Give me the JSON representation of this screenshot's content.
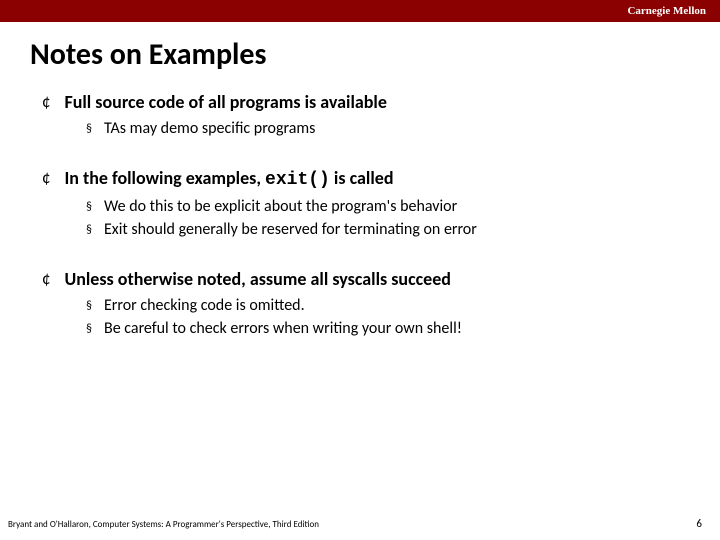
{
  "header": {
    "org": "Carnegie Mellon"
  },
  "title": "Notes on Examples",
  "bullets": [
    {
      "text": "Full source code of all programs is available",
      "sub": [
        "TAs may demo specific programs"
      ]
    },
    {
      "text_before": "In the following examples, ",
      "code": "exit()",
      "text_after": " is called",
      "sub": [
        "We do this to be explicit about the program's behavior",
        "Exit should generally be reserved for terminating on error"
      ]
    },
    {
      "text": "Unless otherwise noted, assume all syscalls succeed",
      "sub": [
        "Error checking code is omitted.",
        "Be careful to check errors when writing your own shell!"
      ]
    }
  ],
  "footer": {
    "left": "Bryant and O'Hallaron, Computer Systems: A Programmer's Perspective, Third Edition",
    "page": "6"
  }
}
